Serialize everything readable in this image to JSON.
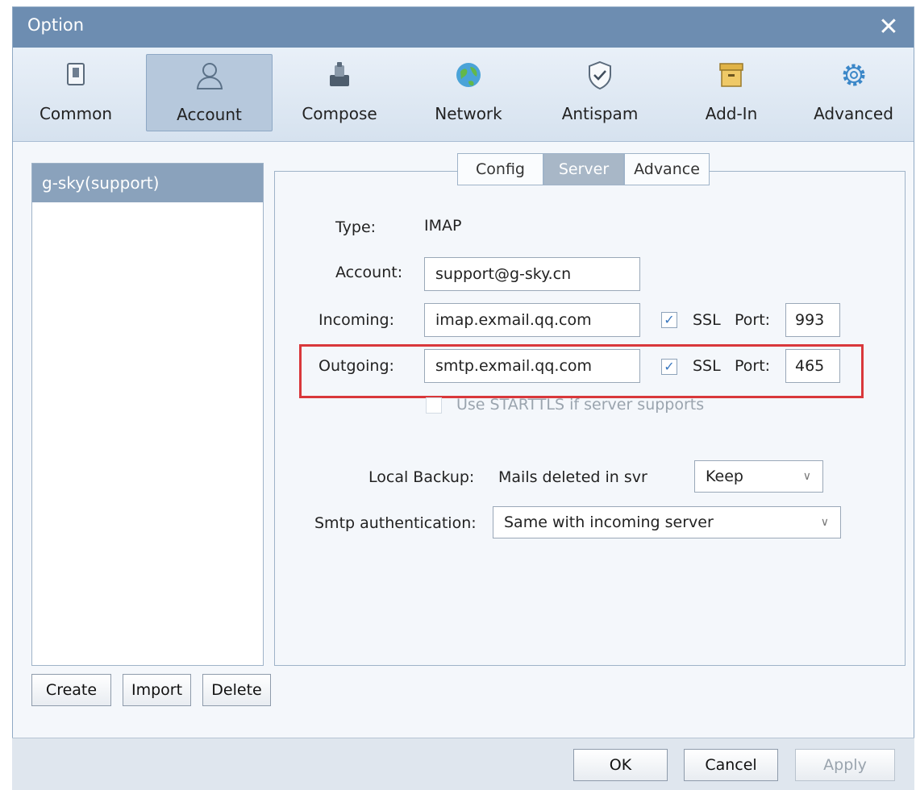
{
  "window": {
    "title": "Option"
  },
  "toolbar": {
    "items": [
      {
        "label": "Common",
        "icon": "common-icon"
      },
      {
        "label": "Account",
        "icon": "account-icon",
        "active": true
      },
      {
        "label": "Compose",
        "icon": "compose-icon"
      },
      {
        "label": "Network",
        "icon": "network-icon"
      },
      {
        "label": "Antispam",
        "icon": "antispam-icon"
      },
      {
        "label": "Add-In",
        "icon": "addin-icon"
      },
      {
        "label": "Advanced",
        "icon": "advanced-icon"
      }
    ]
  },
  "accounts": {
    "items": [
      "g-sky(support)"
    ],
    "buttons": {
      "create": "Create",
      "import": "Import",
      "delete": "Delete"
    }
  },
  "tabs": [
    {
      "label": "Config"
    },
    {
      "label": "Server",
      "active": true
    },
    {
      "label": "Advance"
    }
  ],
  "server": {
    "type_label": "Type:",
    "type_value": "IMAP",
    "account_label": "Account:",
    "account_value": "support@g-sky.cn",
    "incoming_label": "Incoming:",
    "incoming_value": "imap.exmail.qq.com",
    "incoming_ssl": "SSL",
    "incoming_ssl_checked": true,
    "incoming_port_label": "Port:",
    "incoming_port": "993",
    "outgoing_label": "Outgoing:",
    "outgoing_value": "smtp.exmail.qq.com",
    "outgoing_ssl": "SSL",
    "outgoing_ssl_checked": true,
    "outgoing_port_label": "Port:",
    "outgoing_port": "465",
    "starttls_label": "Use STARTTLS if server supports",
    "local_backup_label": "Local Backup:",
    "mails_deleted_label": "Mails deleted in svr",
    "mails_deleted_value": "Keep",
    "smtp_auth_label": "Smtp authentication:",
    "smtp_auth_value": "Same with incoming server"
  },
  "footer": {
    "ok": "OK",
    "cancel": "Cancel",
    "apply": "Apply"
  },
  "colors": {
    "titlebar": "#6d8db1",
    "highlight": "#d9383b",
    "selection": "#8aa2bc"
  }
}
